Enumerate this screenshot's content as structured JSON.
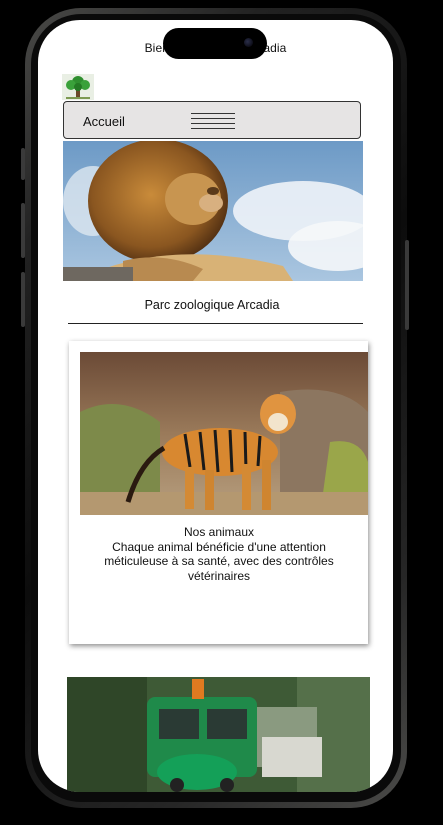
{
  "status": {
    "title": "Bienvenue au zoo Arcadia"
  },
  "navbar": {
    "label": "Accueil"
  },
  "site_title": "Parc zoologique Arcadia",
  "card": {
    "title": "Nos animaux",
    "description": "Chaque animal bénéficie d'une attention méticuleuse à sa santé, avec des contrôles vétérinaires"
  },
  "colors": {
    "navbar_bg": "#e6e4e4",
    "page_bg": "#ffffff",
    "frame": "#1a1a1a"
  },
  "icons": {
    "menu": "hamburger-icon",
    "logo": "tree-logo-icon"
  }
}
